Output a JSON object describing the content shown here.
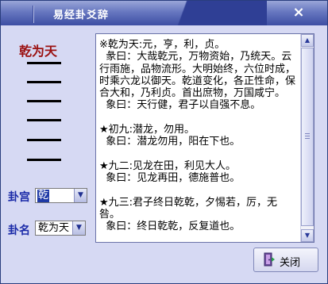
{
  "window": {
    "title": "易经卦爻辞",
    "close_symbol": "×"
  },
  "gua_name": "乾为天",
  "yao_lines": [
    "yang",
    "yang",
    "yang",
    "yang",
    "yang",
    "yang"
  ],
  "form": {
    "gong_label": "卦宫",
    "gong_value": "乾",
    "name_label": "卦名",
    "name_value": "乾为天"
  },
  "text_lines": [
    "※乾为天:元，亨，利，贞。",
    "  彖曰：大哉乾元，万物资始，乃统天。云行雨施，品物流形。大明始终，六位时成，时乘六龙以御天。乾道变化，各正性命，保合大和，乃利贞。首出庶物，万国咸宁。",
    "  象曰：天行健，君子以自强不息。",
    "",
    "★初九:潜龙，勿用。",
    "  象曰：潜龙勿用，阳在下也。",
    "",
    "★九二:见龙在田，利见大人。",
    "  象曰：见龙再田，德施普也。",
    "",
    "★九三:君子终日乾乾，夕惕若，厉，无咎。",
    "  象曰：终日乾乾，反复道也。"
  ],
  "button": {
    "close_label": "关闭"
  },
  "colors": {
    "title_bg": "#3d4ea3",
    "window_bg": "#d6d9f3",
    "gua_name": "#9b1010",
    "label": "#1a2aa8"
  }
}
